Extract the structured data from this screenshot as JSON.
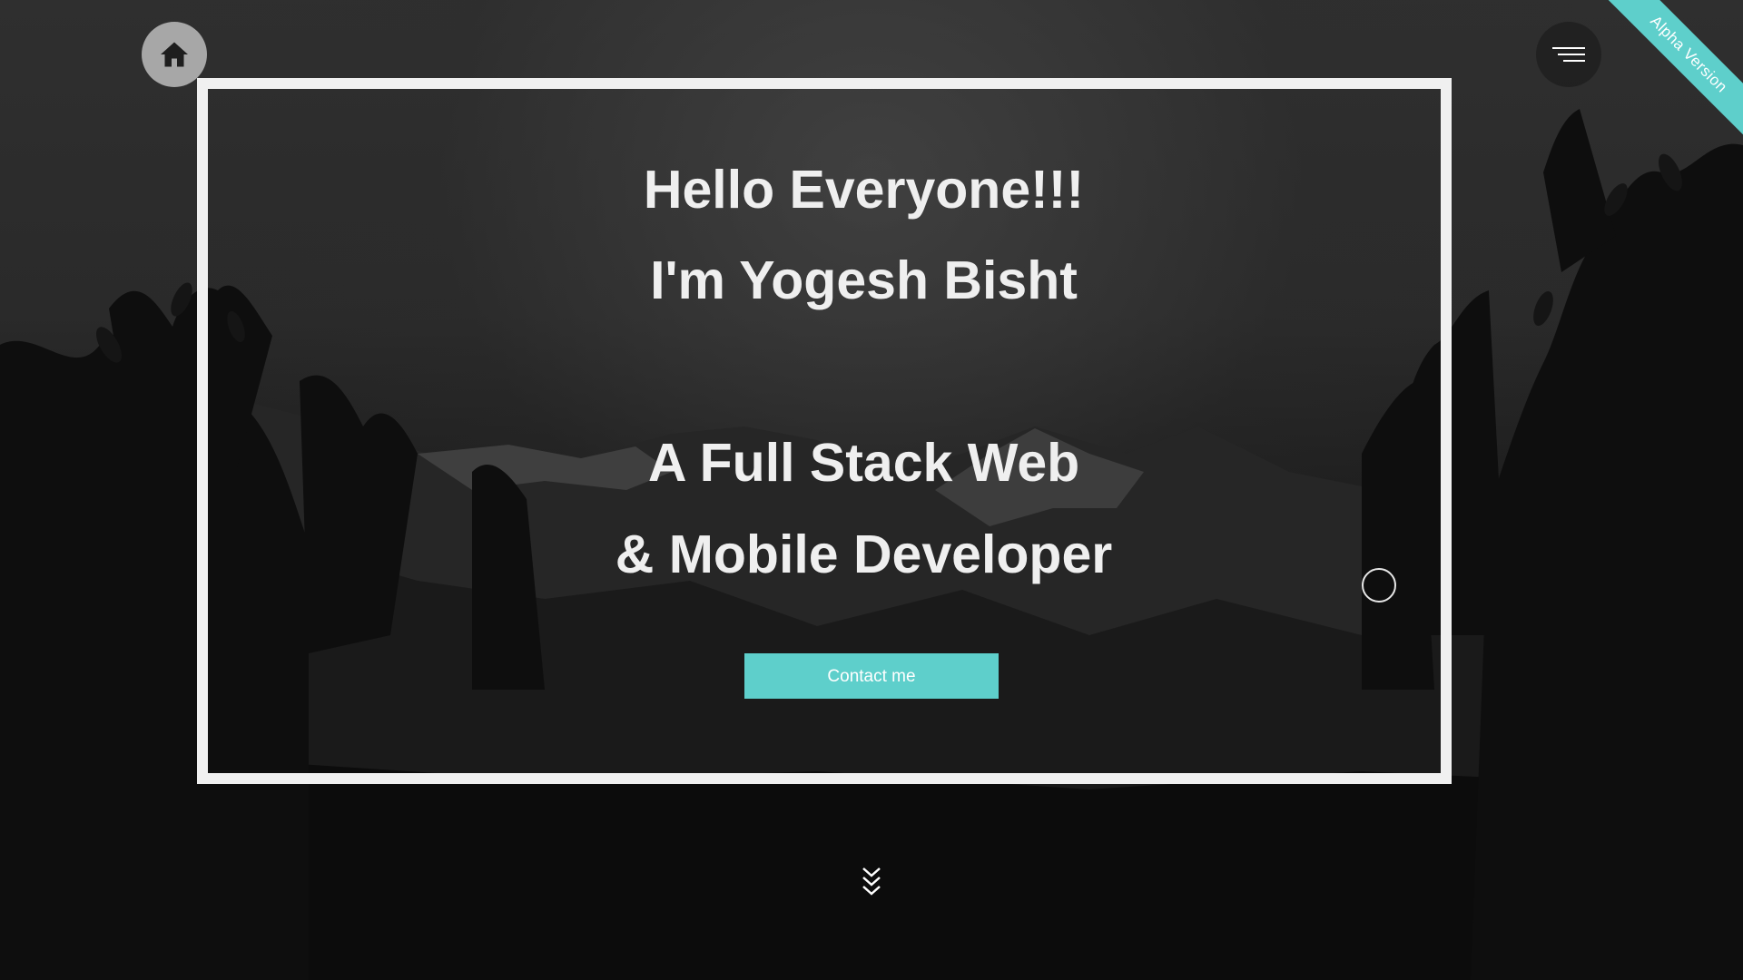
{
  "header": {
    "home_icon": "home-icon",
    "menu_icon": "hamburger-menu-icon",
    "ribbon_label": "Alpha Version"
  },
  "hero": {
    "line1": "Hello Everyone!!!",
    "line2": "I'm Yogesh Bisht",
    "line3": "A Full Stack Web",
    "line4": "& Mobile Developer",
    "contact_label": "Contact me",
    "scroll_icon": "double-chevron-down-icon"
  },
  "colors": {
    "accent": "#5ecfcb",
    "frame": "#f0f0f0",
    "text": "#efefef",
    "home_button": "#a7a7a7",
    "background": "#1c1c1c"
  }
}
